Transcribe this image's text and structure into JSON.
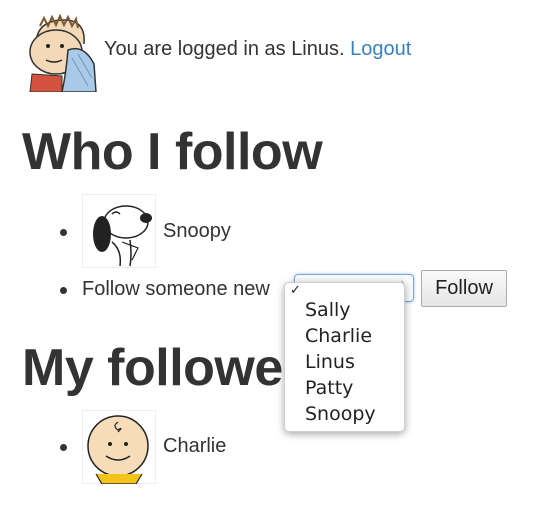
{
  "user_bar": {
    "login_text": "You are logged in as Linus.",
    "logout_label": "Logout",
    "avatar_icon": "linus-avatar"
  },
  "who_i_follow": {
    "heading": "Who I follow",
    "items": [
      {
        "name": "Snoopy",
        "avatar_icon": "snoopy-avatar"
      }
    ],
    "follow_new": {
      "label": "Follow someone new",
      "selected_value": "",
      "options": [
        "Sally",
        "Charlie",
        "Linus",
        "Patty",
        "Snoopy"
      ],
      "button_label": "Follow"
    }
  },
  "my_followers": {
    "heading": "My followers",
    "items": [
      {
        "name": "Charlie",
        "avatar_icon": "charlie-avatar"
      }
    ]
  },
  "colors": {
    "text": "#333333",
    "link": "#3a7fc1",
    "select_focus": "#7fa6d2"
  }
}
